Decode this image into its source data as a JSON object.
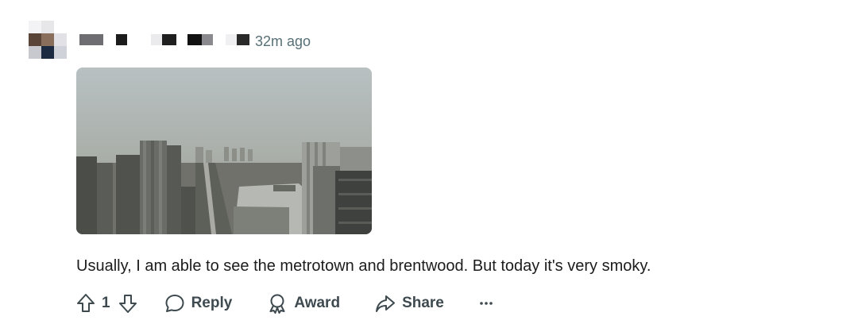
{
  "comment": {
    "timestamp": "32m ago",
    "body": "Usually, I am able to see the metrotown and brentwood. But today it's very smoky.",
    "vote_count": "1"
  },
  "actions": {
    "upvote_icon": "arrow-up-outline",
    "downvote_icon": "arrow-down-outline",
    "reply_label": "Reply",
    "reply_icon": "speech-bubble",
    "award_label": "Award",
    "award_icon": "ribbon",
    "share_label": "Share",
    "share_icon": "forward-arrow",
    "more_icon": "ellipsis"
  },
  "colors": {
    "meta_text": "#576f76",
    "action_text": "#3e4a4f",
    "body_text": "#1c1c1c"
  }
}
